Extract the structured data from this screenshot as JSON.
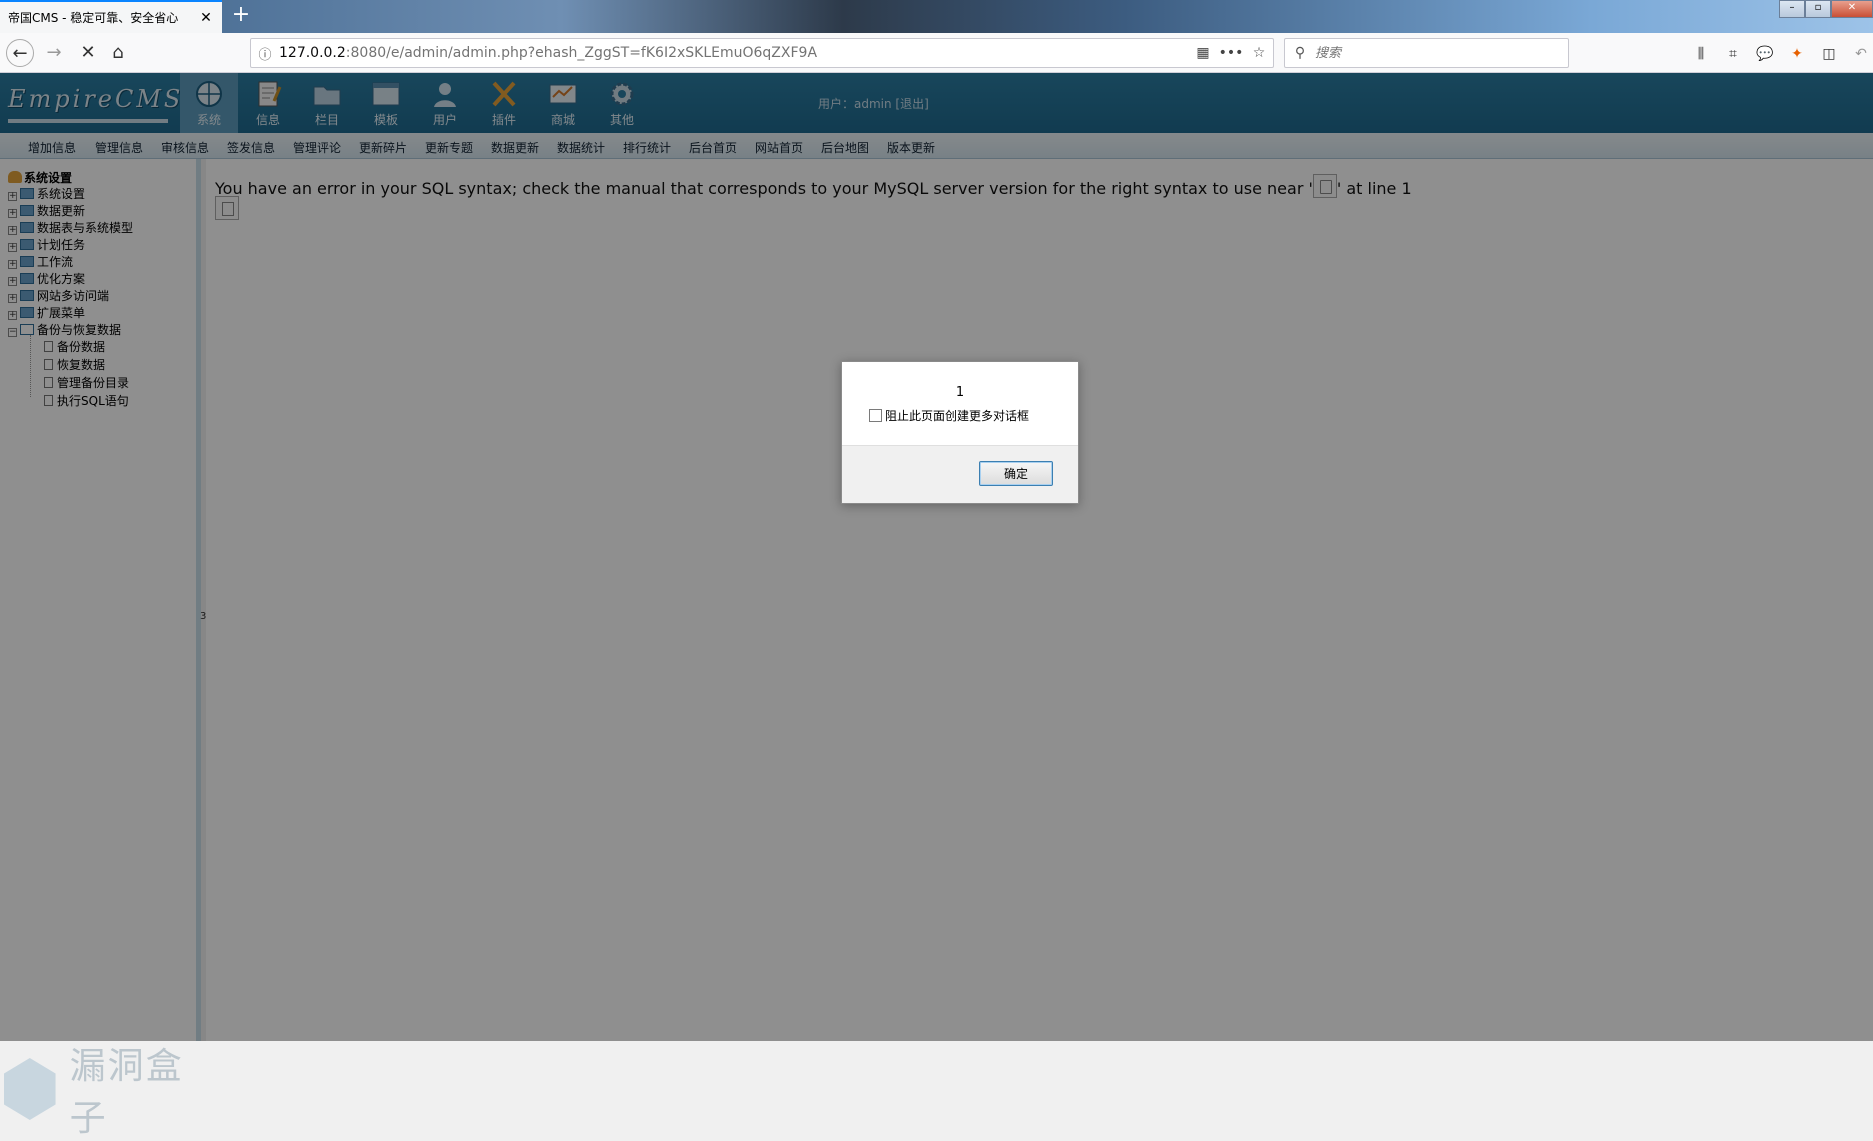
{
  "browser": {
    "tab_title": "帝国CMS - 稳定可靠、安全省心",
    "tab_close": "✕",
    "new_tab": "+",
    "url_host": "127.0.0.2",
    "url_rest": ":8080/e/admin/admin.php?ehash_ZggST=fK6I2xSKLEmuO6qZXF9A",
    "search_placeholder": "搜索",
    "window_buttons": [
      "–",
      "▫",
      "✕"
    ]
  },
  "cms": {
    "logo": "EmpireCMS",
    "modules": [
      {
        "label": "系统",
        "icon": "globe-icon",
        "active": true
      },
      {
        "label": "信息",
        "icon": "note-icon",
        "active": false
      },
      {
        "label": "栏目",
        "icon": "folder-icon",
        "active": false
      },
      {
        "label": "模板",
        "icon": "template-icon",
        "active": false
      },
      {
        "label": "用户",
        "icon": "user-icon",
        "active": false
      },
      {
        "label": "插件",
        "icon": "plugin-icon",
        "active": false
      },
      {
        "label": "商城",
        "icon": "shop-icon",
        "active": false
      },
      {
        "label": "其他",
        "icon": "gear-icon",
        "active": false
      }
    ],
    "user_line": "用户：admin  [退出]",
    "menu": [
      "增加信息",
      "管理信息",
      "审核信息",
      "签发信息",
      "管理评论",
      "更新碎片",
      "更新专题",
      "数据更新",
      "数据统计",
      "排行统计",
      "后台首页",
      "网站首页",
      "后台地图",
      "版本更新"
    ],
    "tree": {
      "root": "系统设置",
      "nodes": [
        "系统设置",
        "数据更新",
        "数据表与系统模型",
        "计划任务",
        "工作流",
        "优化方案",
        "网站多访问端",
        "扩展菜单",
        "备份与恢复数据"
      ],
      "leaves": [
        "备份数据",
        "恢复数据",
        "管理备份目录",
        "执行SQL语句"
      ]
    },
    "splitter_mark": "3",
    "watermark": "漏洞盒子"
  },
  "content": {
    "error_before": "You have an error in your SQL syntax; check the manual that corresponds to your MySQL server version for the right syntax to use near '",
    "error_after": "' at line 1"
  },
  "dialog": {
    "message": "1",
    "checkbox_label": "阻止此页面创建更多对话框",
    "ok_label": "确定"
  },
  "colors": {
    "cms_header": "#2c7ea3",
    "accent": "#0a84ff"
  }
}
